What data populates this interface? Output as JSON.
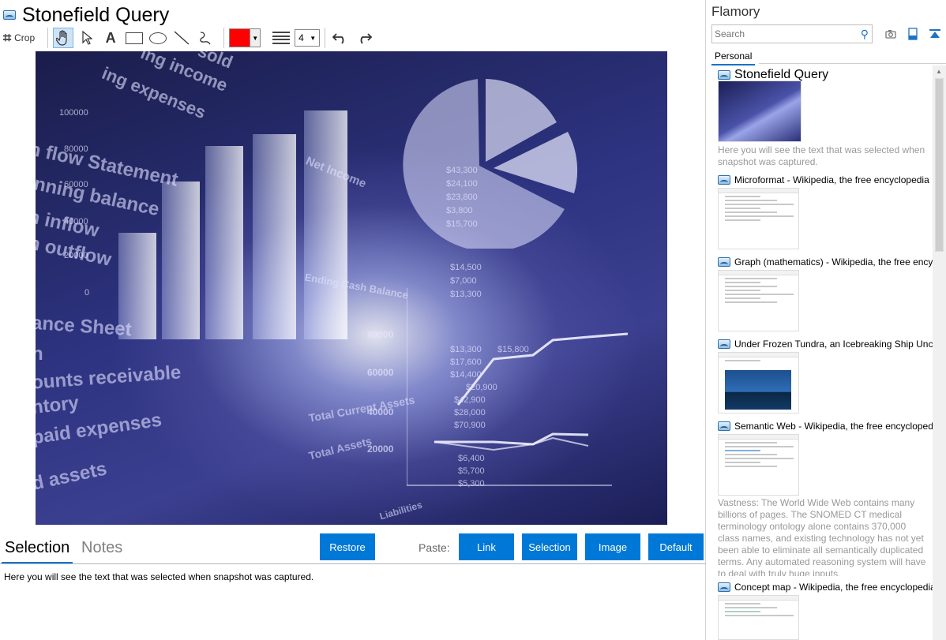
{
  "snapshot": {
    "title": "Stonefield Query"
  },
  "toolbar": {
    "crop_label": "Crop",
    "text_tool_glyph": "A",
    "line_width_value": "4",
    "color_value": "#ff0000"
  },
  "canvas_text": {
    "sold": "sold",
    "income": "ing income",
    "expenses": "ing expenses",
    "flow_statement": "h flow Statement",
    "opening_balance": "inning balance",
    "inflow": "h inflow",
    "outflow": "h outflow",
    "net_income": "Net Income",
    "ending_cash_balance": "Ending Cash Balance",
    "balance_sheet": "ance Sheet",
    "h": "h",
    "accounts_receivable": "ounts receivable",
    "inventory": "ntory",
    "prepaid_expenses": "paid expenses",
    "fixed_assets": "d assets",
    "total_current_assets": "Total Current Assets",
    "total_assets": "Total Assets",
    "liabilities": "Liabilities",
    "axis_left": [
      "100000",
      "80000",
      "60000",
      "40000",
      "20000",
      "0"
    ],
    "axis_right": [
      "80000",
      "60000",
      "40000",
      "20000"
    ],
    "numbers": [
      "$13,300",
      "$15,800",
      "$17,600",
      "$14,400",
      "$20,900",
      "$42,900",
      "$28,000",
      "$70,900",
      "$6,400",
      "$5,700",
      "$5,300",
      "$14,500",
      "$7,000",
      "$13,300",
      "$43,300",
      "$24,100",
      "$23,800",
      "$3,800",
      "$15,700"
    ]
  },
  "bottom": {
    "tab_selection": "Selection",
    "tab_notes": "Notes",
    "restore_label": "Restore",
    "paste_label": "Paste:",
    "link_label": "Link",
    "selection_label": "Selection",
    "image_label": "Image",
    "default_label": "Default",
    "selection_text": "Here you will see the text that was selected when snapshot was captured."
  },
  "sidebar": {
    "app_name": "Flamory",
    "search_placeholder": "Search",
    "tab_personal": "Personal",
    "entries": [
      {
        "title": "Stonefield Query",
        "desc": "Here you will see the text that was selected when snapshot was captured."
      },
      {
        "title": "Microformat - Wikipedia, the free encyclopedia",
        "desc": ""
      },
      {
        "title": "Graph (mathematics) - Wikipedia, the free encyclopedia",
        "desc": ""
      },
      {
        "title": "Under Frozen Tundra, an Icebreaking Ship Uncovers",
        "desc": ""
      },
      {
        "title": "Semantic Web - Wikipedia, the free encyclopedia",
        "desc": "Vastness: The World Wide Web contains many billions of pages. The SNOMED CT medical terminology ontology alone contains 370,000 class names, and existing technology has not yet been able to eliminate all semantically duplicated terms. Any automated reasoning system will have to deal with truly huge inputs."
      },
      {
        "title": "Concept map - Wikipedia, the free encyclopedia",
        "desc": ""
      }
    ]
  }
}
